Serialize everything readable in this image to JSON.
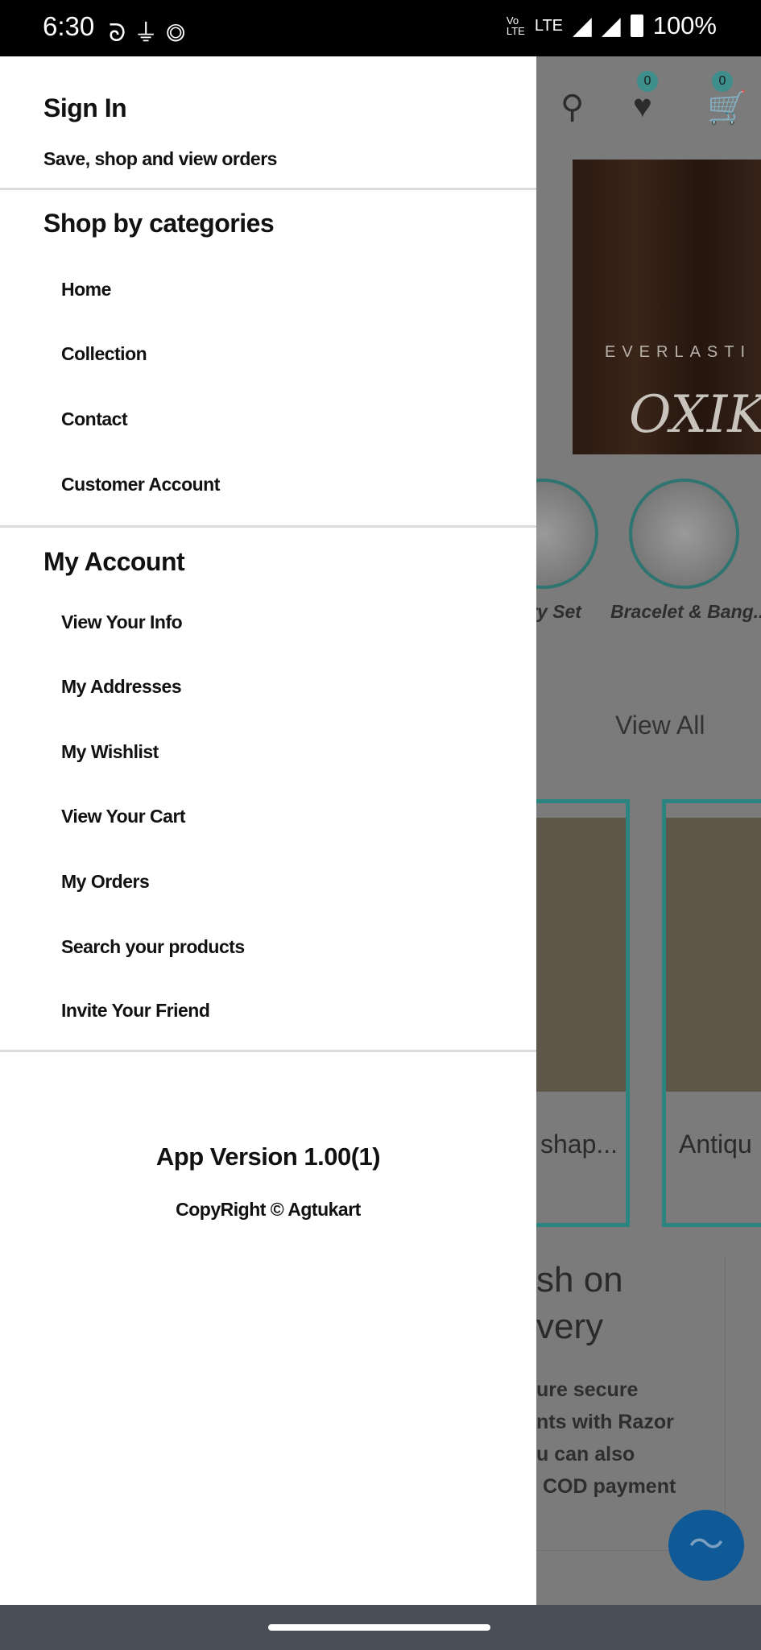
{
  "status_bar": {
    "time": "6:30",
    "battery": "100%",
    "network": "LTE",
    "icons": [
      "airtel-icon",
      "usb-icon",
      "data-saver-icon",
      "volte-icon",
      "signal-icon",
      "signal-icon",
      "battery-charging-icon"
    ]
  },
  "background": {
    "header_counts": {
      "wishlist": "0",
      "cart": "0"
    },
    "banner": {
      "line1": "EVERLASTI",
      "line2": "OXIK"
    },
    "categories": [
      "ry Set",
      "Bracelet & Bang..."
    ],
    "view_all": "View All",
    "products": [
      "shap...",
      "Antiqu"
    ],
    "cod": {
      "title_line1": "sh on",
      "title_line2": "very",
      "text": [
        "ure secure",
        "nts with Razor",
        "u can also",
        "COD payment"
      ]
    }
  },
  "drawer": {
    "sign_in": {
      "title": "Sign In",
      "subtitle": "Save, shop and view orders"
    },
    "shop_by_categories": {
      "title": "Shop by categories",
      "items": [
        "Home",
        "Collection",
        "Contact",
        "Customer Account"
      ]
    },
    "my_account": {
      "title": "My Account",
      "items": [
        "View Your Info",
        "My Addresses",
        "My Wishlist",
        "View Your Cart",
        "My Orders",
        "Search your products",
        "Invite Your Friend"
      ]
    },
    "app_version": "App Version 1.00(1)",
    "copyright": "CopyRight © Agtukart"
  },
  "colors": {
    "accent": "#2b8480",
    "drawer_bg": "#ffffff",
    "scrim": "#7b7b7b",
    "messenger": "#0f5a96"
  }
}
